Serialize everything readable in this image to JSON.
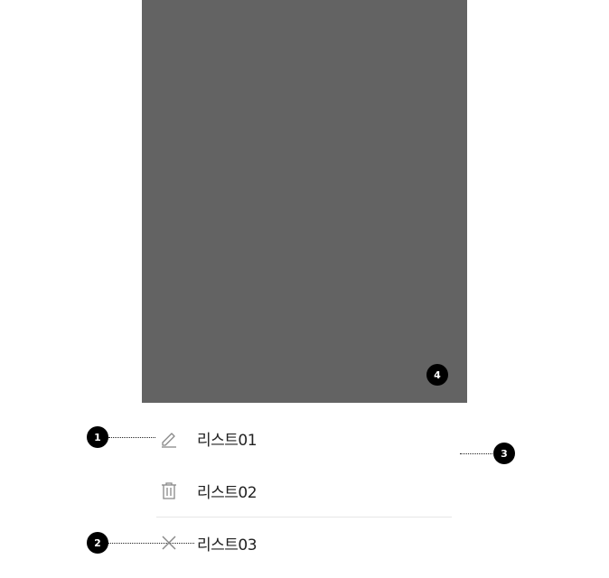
{
  "callouts": {
    "c1": "1",
    "c2": "2",
    "c3": "3",
    "c4": "4"
  },
  "menu": {
    "items": [
      {
        "label": "리스트01",
        "icon": "pencil-icon"
      },
      {
        "label": "리스트02",
        "icon": "trash-icon"
      },
      {
        "label": "리스트03",
        "icon": "close-icon"
      }
    ]
  },
  "colors": {
    "overlay": "#636363",
    "badge": "#000000",
    "text": "#222222",
    "icon": "#888888",
    "divider": "#e6e6e6"
  }
}
